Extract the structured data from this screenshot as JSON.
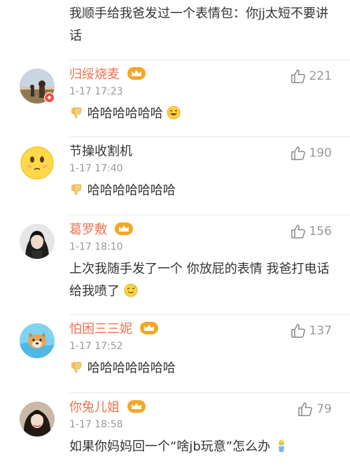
{
  "top_snippet": {
    "text": "我顺手给我爸发过一个表情包：你jj太短不要讲话"
  },
  "comments": [
    {
      "username": "归绥烧麦",
      "time": "1-17 17:23",
      "likes": "221",
      "text": "哈哈哈哈哈哈",
      "text_prefix_icon": "thumbs-down-emoji",
      "text_suffix_icon": "laughing-emoji",
      "username_color": "#eb7350",
      "avatar": "photo-avatar",
      "vip": true
    },
    {
      "username": "节操收割机",
      "time": "1-17 17:40",
      "likes": "190",
      "text": "哈哈哈哈哈哈哈",
      "text_prefix_icon": "thumbs-down-emoji",
      "username_color": "#333333",
      "avatar": "yellow-face-avatar",
      "vip": false
    },
    {
      "username": "葛罗敷",
      "time": "1-17 18:10",
      "likes": "156",
      "text": "上次我随手发了一个  你放屁的表情  我爸打电话给我喷了",
      "text_suffix_icon": "sweat-smile-emoji",
      "username_color": "#eb7350",
      "avatar": "woman-portrait-avatar",
      "vip": false
    },
    {
      "username": "怕困三三妮",
      "time": "1-17 17:52",
      "likes": "137",
      "text": "哈哈哈哈哈哈哈",
      "text_prefix_icon": "thumbs-down-emoji",
      "username_color": "#eb7350",
      "avatar": "dog-swimming-avatar",
      "vip": false
    },
    {
      "username": "你兔儿姐",
      "time": "1-17 18:58",
      "likes": "79",
      "text": "如果你妈妈回一个“啥jb玩意”怎么办",
      "text_suffix_icon": "crying-figure-emoji",
      "username_color": "#eb7350",
      "avatar": "woman-dark-hair-avatar",
      "vip": false
    }
  ],
  "colors": {
    "username_vip": "#eb7350",
    "meta_gray": "#999999",
    "text": "#333333",
    "divider": "#e9e9e9"
  }
}
